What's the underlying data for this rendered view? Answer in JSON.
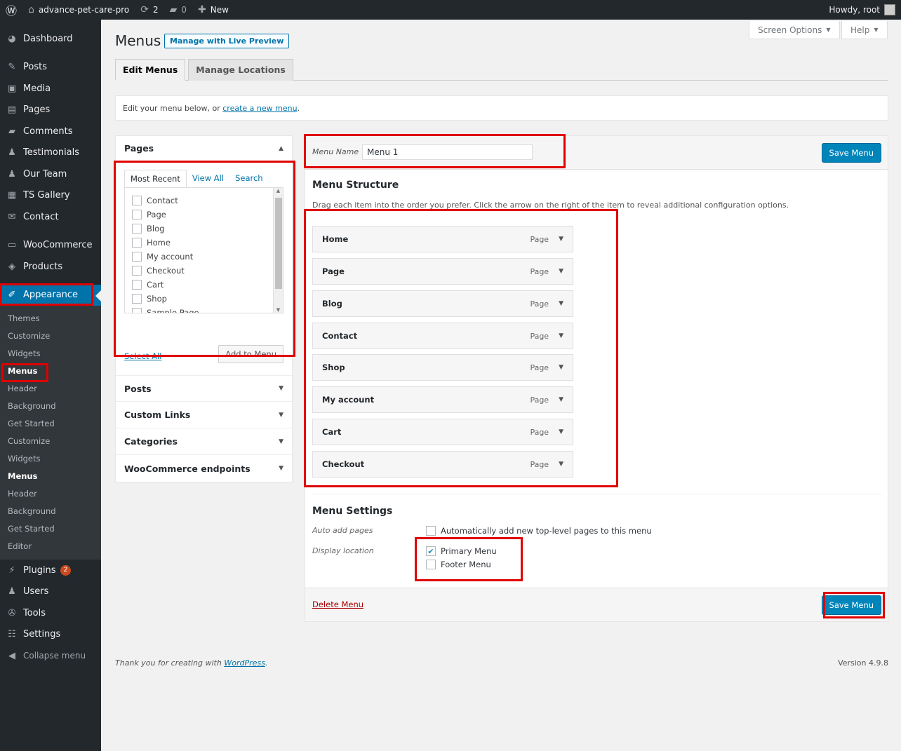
{
  "admin_bar": {
    "site_name": "advance-pet-care-pro",
    "updates_count": "2",
    "comments_count": "0",
    "new_label": "New",
    "howdy": "Howdy, root"
  },
  "sidebar": {
    "items_top": [
      {
        "label": "Dashboard",
        "icon": "dashboard-icon"
      }
    ],
    "items": [
      {
        "label": "Posts",
        "icon": "pin-icon"
      },
      {
        "label": "Media",
        "icon": "media-icon"
      },
      {
        "label": "Pages",
        "icon": "pages-icon"
      },
      {
        "label": "Comments",
        "icon": "comment-icon"
      },
      {
        "label": "Testimonials",
        "icon": "person-icon"
      },
      {
        "label": "Our Team",
        "icon": "person-icon"
      },
      {
        "label": "TS Gallery",
        "icon": "gallery-icon"
      },
      {
        "label": "Contact",
        "icon": "mail-icon"
      }
    ],
    "woo": [
      {
        "label": "WooCommerce",
        "icon": "woo-icon"
      },
      {
        "label": "Products",
        "icon": "box-icon"
      }
    ],
    "appearance": "Appearance",
    "submenu": [
      "Themes",
      "Customize",
      "Widgets",
      "Menus",
      "Header",
      "Background",
      "Get Started",
      "Customize",
      "Widgets",
      "Menus",
      "Header",
      "Background",
      "Get Started",
      "Editor"
    ],
    "plugins": "Plugins",
    "plugins_badge": "2",
    "bottom": [
      {
        "label": "Users",
        "icon": "users-icon"
      },
      {
        "label": "Tools",
        "icon": "wrench-icon"
      },
      {
        "label": "Settings",
        "icon": "settings-icon"
      }
    ],
    "collapse": "Collapse menu"
  },
  "header": {
    "screen_options": "Screen Options",
    "help": "Help",
    "title": "Menus",
    "live_preview": "Manage with Live Preview",
    "tabs": [
      "Edit Menus",
      "Manage Locations"
    ]
  },
  "notice": {
    "text": "Edit your menu below, or ",
    "link": "create a new menu",
    "end": "."
  },
  "pages_box": {
    "title": "Pages",
    "tabs": [
      "Most Recent",
      "View All",
      "Search"
    ],
    "items": [
      "Contact",
      "Page",
      "Blog",
      "Home",
      "My account",
      "Checkout",
      "Cart",
      "Shop",
      "Sample Page"
    ],
    "select_all": "Select All",
    "add_button": "Add to Menu"
  },
  "accordion_sections": [
    "Posts",
    "Custom Links",
    "Categories",
    "WooCommerce endpoints"
  ],
  "menu_editor": {
    "name_label": "Menu Name",
    "name_value": "Menu 1",
    "save_label": "Save Menu",
    "structure_title": "Menu Structure",
    "structure_desc": "Drag each item into the order you prefer. Click the arrow on the right of the item to reveal additional configuration options.",
    "items": [
      {
        "title": "Home",
        "type": "Page"
      },
      {
        "title": "Page",
        "type": "Page"
      },
      {
        "title": "Blog",
        "type": "Page"
      },
      {
        "title": "Contact",
        "type": "Page"
      },
      {
        "title": "Shop",
        "type": "Page"
      },
      {
        "title": "My account",
        "type": "Page"
      },
      {
        "title": "Cart",
        "type": "Page"
      },
      {
        "title": "Checkout",
        "type": "Page"
      }
    ],
    "settings_title": "Menu Settings",
    "auto_add_label": "Auto add pages",
    "auto_add_text": "Automatically add new top-level pages to this menu",
    "display_label": "Display location",
    "locations": [
      {
        "label": "Primary Menu",
        "checked": true
      },
      {
        "label": "Footer Menu",
        "checked": false
      }
    ],
    "delete_label": "Delete Menu"
  },
  "footer": {
    "thanks": "Thank you for creating with ",
    "wp_link": "WordPress",
    "end": ".",
    "version": "Version 4.9.8"
  },
  "colors": {
    "accent": "#0073aa",
    "highlight": "#e00000",
    "sidebar_bg": "#23282d"
  }
}
